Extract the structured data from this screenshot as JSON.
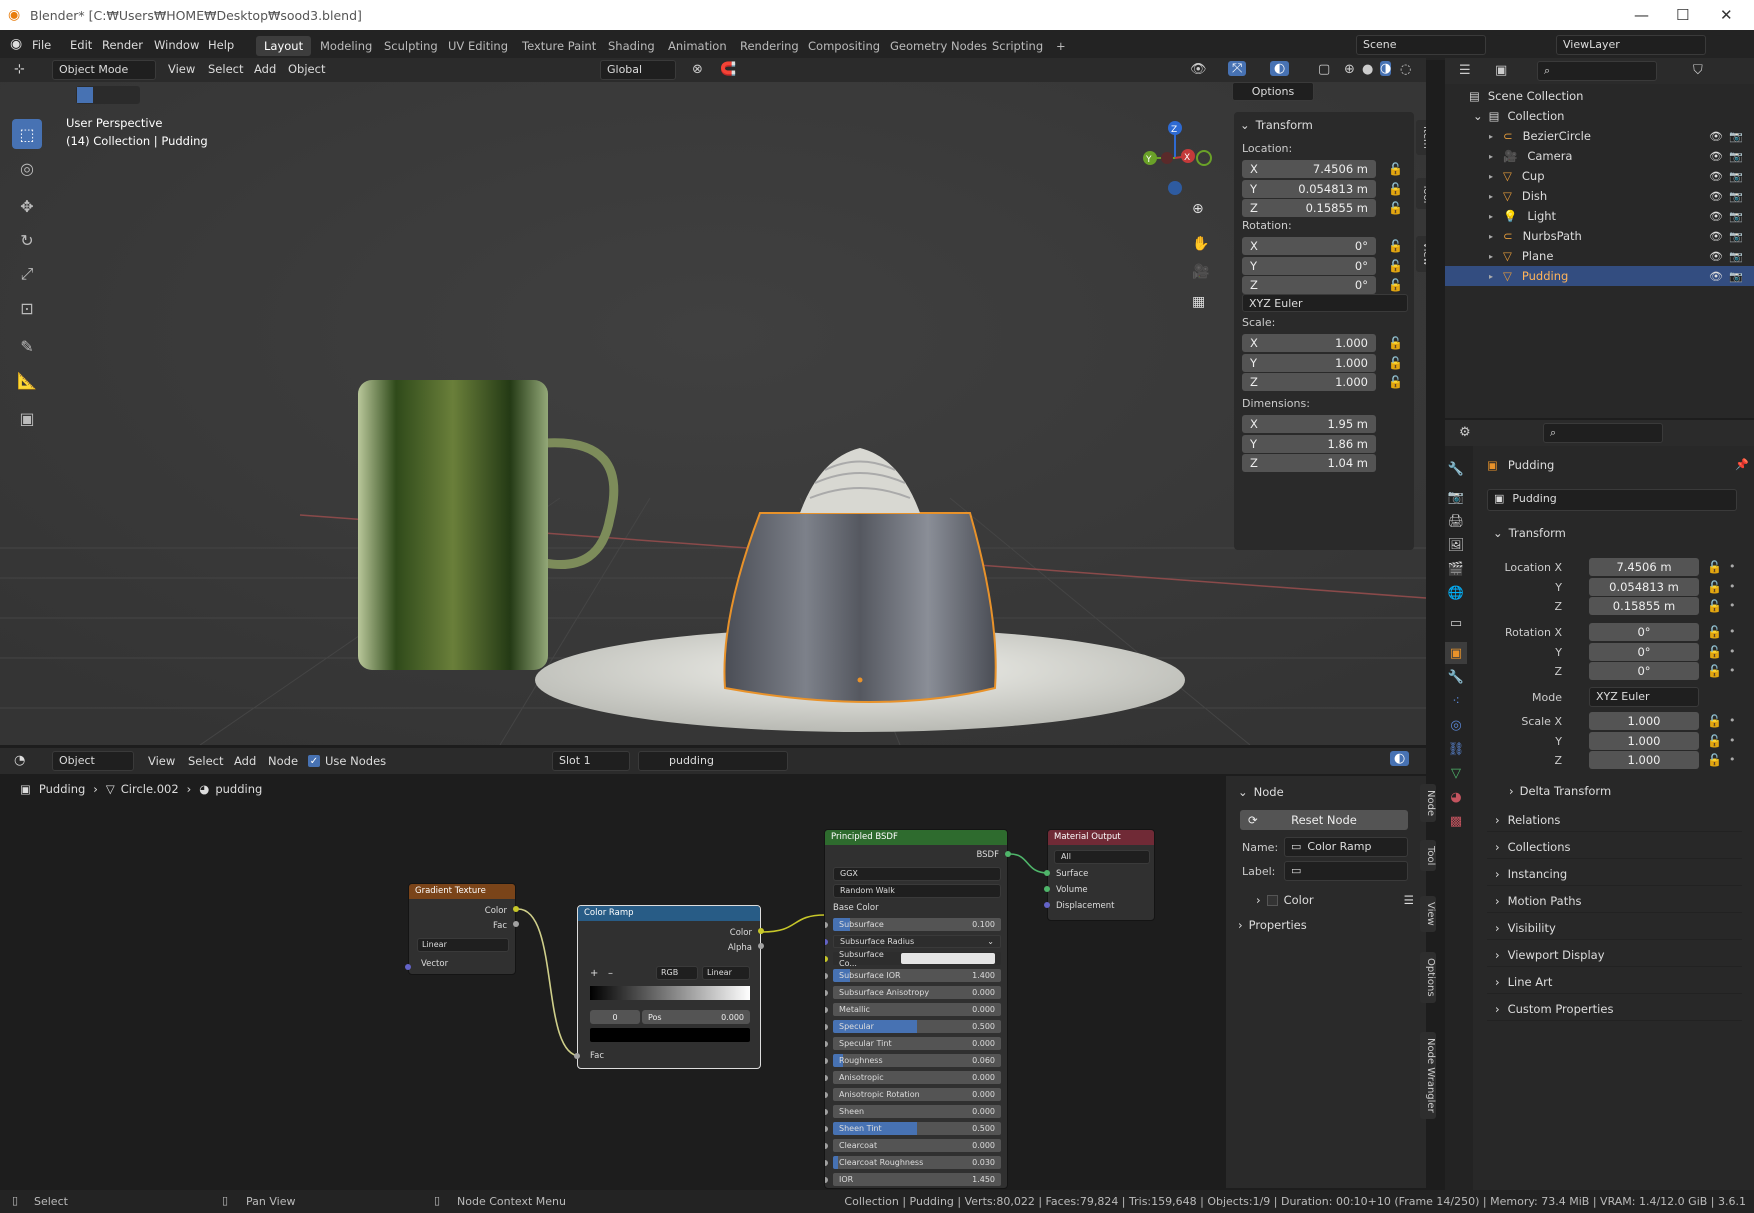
{
  "window": {
    "title": "Blender* [C:₩Users₩HOME₩Desktop₩sood3.blend]",
    "min": "—",
    "max": "☐",
    "close": "✕"
  },
  "menu": [
    "File",
    "Edit",
    "Render",
    "Window",
    "Help"
  ],
  "workspaces": [
    "Layout",
    "Modeling",
    "Sculpting",
    "UV Editing",
    "Texture Paint",
    "Shading",
    "Animation",
    "Rendering",
    "Compositing",
    "Geometry Nodes",
    "Scripting",
    "+"
  ],
  "active_workspace": "Layout",
  "scene": {
    "name": "Scene",
    "view_layer": "ViewLayer"
  },
  "viewport": {
    "mode": "Object Mode",
    "menus": [
      "View",
      "Select",
      "Add",
      "Object"
    ],
    "transform_orientation": "Global",
    "options": "Options",
    "overlay_title": "User Perspective",
    "overlay_sub": "(14) Collection | Pudding",
    "tabs": [
      "Item",
      "Tool",
      "View"
    ],
    "transform": {
      "header": "Transform",
      "location_label": "Location:",
      "rotation_label": "Rotation:",
      "scale_label": "Scale:",
      "dimensions_label": "Dimensions:",
      "location": [
        {
          "a": "X",
          "v": "7.4506 m"
        },
        {
          "a": "Y",
          "v": "0.054813 m"
        },
        {
          "a": "Z",
          "v": "0.15855 m"
        }
      ],
      "rotation": [
        {
          "a": "X",
          "v": "0°"
        },
        {
          "a": "Y",
          "v": "0°"
        },
        {
          "a": "Z",
          "v": "0°"
        }
      ],
      "rotation_mode": "XYZ Euler",
      "scale": [
        {
          "a": "X",
          "v": "1.000"
        },
        {
          "a": "Y",
          "v": "1.000"
        },
        {
          "a": "Z",
          "v": "1.000"
        }
      ],
      "dimensions": [
        {
          "a": "X",
          "v": "1.95 m"
        },
        {
          "a": "Y",
          "v": "1.86 m"
        },
        {
          "a": "Z",
          "v": "1.04 m"
        }
      ]
    },
    "gizmo": {
      "z": "Z",
      "y": "Y",
      "x": "X"
    }
  },
  "node_editor": {
    "mode": "Object",
    "menus": [
      "View",
      "Select",
      "Add",
      "Node"
    ],
    "use_nodes": "Use Nodes",
    "slot": "Slot 1",
    "material": "pudding",
    "breadcrumb": [
      "Pudding",
      "Circle.002",
      "pudding"
    ],
    "tabs": [
      "Node",
      "Tool",
      "View",
      "Options",
      "Node Wrangler"
    ],
    "sidebar": {
      "header": "Node",
      "reset": "Reset Node",
      "name_label": "Name:",
      "name": "Color Ramp",
      "label_label": "Label:",
      "label": "",
      "color": "Color",
      "properties": "Properties"
    },
    "gradient": {
      "title": "Gradient Texture",
      "out1": "Color",
      "out2": "Fac",
      "type": "Linear",
      "in": "Vector"
    },
    "ramp": {
      "title": "Color Ramp",
      "out1": "Color",
      "out2": "Alpha",
      "mode": "RGB",
      "interp": "Linear",
      "index": "0",
      "pos_label": "Pos",
      "pos": "0.000",
      "in": "Fac",
      "plus": "+",
      "minus": "–"
    },
    "bsdf": {
      "title": "Principled BSDF",
      "out": "BSDF",
      "dist": "GGX",
      "sss": "Random Walk",
      "base": "Base Color",
      "rows": [
        {
          "n": "Subsurface",
          "v": "0.100",
          "f": 0.1,
          "c": "#4772b3"
        },
        {
          "n": "Subsurface Radius",
          "v": "",
          "f": 0,
          "c": "#4772b3"
        },
        {
          "n": "Subsurface Co...",
          "v": "",
          "f": 0,
          "c": "#e5e5e5"
        },
        {
          "n": "Subsurface IOR",
          "v": "1.400",
          "f": 0.1,
          "c": "#4772b3"
        },
        {
          "n": "Subsurface Anisotropy",
          "v": "0.000",
          "f": 0,
          "c": "#4772b3"
        },
        {
          "n": "Metallic",
          "v": "0.000",
          "f": 0,
          "c": "#4772b3"
        },
        {
          "n": "Specular",
          "v": "0.500",
          "f": 0.5,
          "c": "#4772b3"
        },
        {
          "n": "Specular Tint",
          "v": "0.000",
          "f": 0,
          "c": "#4772b3"
        },
        {
          "n": "Roughness",
          "v": "0.060",
          "f": 0.06,
          "c": "#4772b3"
        },
        {
          "n": "Anisotropic",
          "v": "0.000",
          "f": 0,
          "c": "#4772b3"
        },
        {
          "n": "Anisotropic Rotation",
          "v": "0.000",
          "f": 0,
          "c": "#4772b3"
        },
        {
          "n": "Sheen",
          "v": "0.000",
          "f": 0,
          "c": "#4772b3"
        },
        {
          "n": "Sheen Tint",
          "v": "0.500",
          "f": 0.5,
          "c": "#4772b3"
        },
        {
          "n": "Clearcoat",
          "v": "0.000",
          "f": 0,
          "c": "#4772b3"
        },
        {
          "n": "Clearcoat Roughness",
          "v": "0.030",
          "f": 0.03,
          "c": "#4772b3"
        },
        {
          "n": "IOR",
          "v": "1.450",
          "f": 0,
          "c": "#4772b3"
        }
      ]
    },
    "output": {
      "title": "Material Output",
      "target": "All",
      "in1": "Surface",
      "in2": "Volume",
      "in3": "Displacement"
    }
  },
  "outliner": {
    "root": "Scene Collection",
    "collection": "Collection",
    "items": [
      {
        "name": "BezierCircle",
        "color": "#e49b3a"
      },
      {
        "name": "Camera",
        "color": "#e49b3a"
      },
      {
        "name": "Cup",
        "color": "#e49b3a"
      },
      {
        "name": "Dish",
        "color": "#e49b3a"
      },
      {
        "name": "Light",
        "color": "#e49b3a"
      },
      {
        "name": "NurbsPath",
        "color": "#e49b3a"
      },
      {
        "name": "Plane",
        "color": "#e49b3a"
      },
      {
        "name": "Pudding",
        "color": "#e49b3a"
      }
    ],
    "selected": "Pudding"
  },
  "properties": {
    "object": "Pudding",
    "data": "Pudding",
    "transform": "Transform",
    "location": [
      {
        "l": "Location X",
        "v": "7.4506 m"
      },
      {
        "l": "Y",
        "v": "0.054813 m"
      },
      {
        "l": "Z",
        "v": "0.15855 m"
      }
    ],
    "rotation": [
      {
        "l": "Rotation X",
        "v": "0°"
      },
      {
        "l": "Y",
        "v": "0°"
      },
      {
        "l": "Z",
        "v": "0°"
      }
    ],
    "mode_label": "Mode",
    "mode": "XYZ Euler",
    "scale": [
      {
        "l": "Scale X",
        "v": "1.000"
      },
      {
        "l": "Y",
        "v": "1.000"
      },
      {
        "l": "Z",
        "v": "1.000"
      }
    ],
    "delta": "Delta Transform",
    "sections": [
      "Relations",
      "Collections",
      "Instancing",
      "Motion Paths",
      "Visibility",
      "Viewport Display",
      "Line Art",
      "Custom Properties"
    ]
  },
  "status": {
    "select": "Select",
    "pan": "Pan View",
    "ctx": "Node Context Menu",
    "stats": "Collection | Pudding | Verts:80,022 | Faces:79,824 | Tris:159,648 | Objects:1/9 | Duration: 00:10+10 (Frame 14/250) | Memory: 73.4 MiB | VRAM: 1.4/12.0 GiB | 3.6.1"
  }
}
